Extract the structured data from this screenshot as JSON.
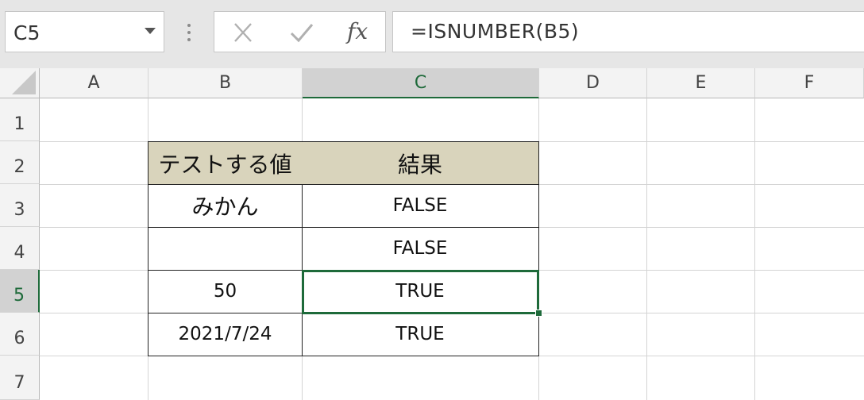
{
  "formula_bar": {
    "name_box": "C5",
    "fx_label": "fx",
    "formula": "=ISNUMBER(B5)"
  },
  "columns": [
    "A",
    "B",
    "C",
    "D",
    "E",
    "F"
  ],
  "selected_column": "C",
  "rows": [
    "1",
    "2",
    "3",
    "4",
    "5",
    "6",
    "7"
  ],
  "selected_row": "5",
  "table": {
    "header": {
      "value_label": "テストする値",
      "result_label": "結果"
    },
    "rows": [
      {
        "value": "みかん",
        "result": "FALSE"
      },
      {
        "value": "",
        "result": "FALSE"
      },
      {
        "value": "50",
        "result": "TRUE"
      },
      {
        "value": "2021/7/24",
        "result": "TRUE"
      }
    ]
  },
  "colors": {
    "accent": "#1e6a3a",
    "header_fill": "#d9d4bc"
  },
  "icons": [
    "chevron-down-icon",
    "grip-icon",
    "close-icon",
    "check-icon",
    "function-icon",
    "select-all-icon"
  ]
}
